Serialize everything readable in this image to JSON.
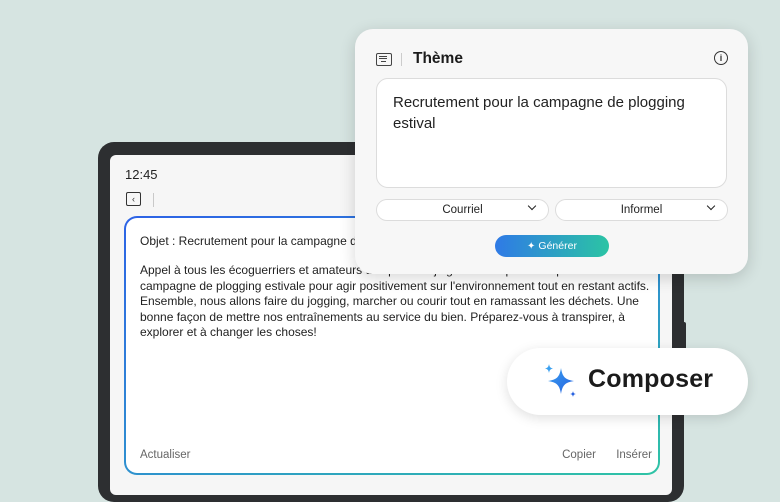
{
  "status_bar": {
    "time": "12:45"
  },
  "email": {
    "subject": "Objet : Recrutement pour la campagne de plogging estival",
    "body": "Appel à tous les écoguerriers et amateurs de sport ! Rejoignez-nous pour une passionnante campagne de plogging estivale pour agir positivement sur l'environnement tout en restant actifs. Ensemble, nous allons faire du jogging, marcher ou courir tout en ramassant les déchets. Une bonne façon de mettre nos entraînements au service du bien. Préparez-vous à transpirer, à explorer et à changer les choses!",
    "actions": {
      "refresh": "Actualiser",
      "copy": "Copier",
      "insert": "Insérer"
    }
  },
  "theme_panel": {
    "title": "Thème",
    "topic": "Recrutement pour la campagne de plogging estival",
    "format_dropdown": "Courriel",
    "tone_dropdown": "Informel",
    "generate_label": "Générer"
  },
  "badge": {
    "label": "Composer"
  },
  "colors": {
    "accent_blue": "#2f6fe6",
    "accent_teal": "#2bc4a4",
    "background": "#d6e4e1"
  },
  "icons": [
    "back-icon",
    "keyboard-icon",
    "info-icon",
    "sparkle-icon",
    "chevron-down-icon"
  ]
}
